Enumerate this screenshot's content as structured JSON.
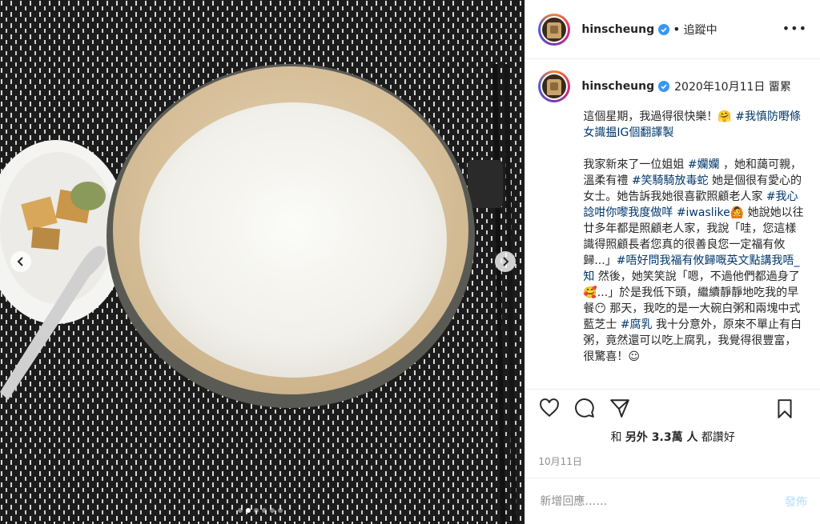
{
  "header": {
    "username": "hinscheung",
    "separator": "•",
    "follow_status": "追蹤中",
    "more_label": "•••"
  },
  "caption": {
    "username": "hinscheung",
    "date_text": "2020年10月11日 畱累",
    "body": [
      {
        "t": "這個星期，我過得很快樂！🤗 "
      },
      {
        "t": "#我慎防嘢條女識揾IG個翻譯製",
        "tag": true
      },
      {
        "t": "\n\n我家新來了一位姐姐 "
      },
      {
        "t": "#孄孄",
        "tag": true
      },
      {
        "t": " ，她和藹可親，溫柔有禮 "
      },
      {
        "t": "#笑騎騎放毒蛇",
        "tag": true
      },
      {
        "t": " 她是個很有愛心的女士。她告訴我她很喜歡照顧老人家 "
      },
      {
        "t": "#我心諗咁你嚟我度做咩",
        "tag": true
      },
      {
        "t": " "
      },
      {
        "t": "#iwaslike",
        "tag": true
      },
      {
        "t": "🙆 她說她以往廿多年都是照顧老人家，我說「哇，您這樣識得照顧長者您真的很善良您一定福有攸歸...」"
      },
      {
        "t": "#唔好問我福有攸歸嘅英文點講我唔_知",
        "tag": true
      },
      {
        "t": " 然後，她笑笑說「嗯，不過他們都過身了🥰...」於是我低下頭，繼續靜靜地吃我的早餐😶 那天，我吃的是一大碗白粥和兩塊中式藍芝士 "
      },
      {
        "t": "#腐乳",
        "tag": true
      },
      {
        "t": " 我十分意外，原來不單止有白粥，竟然還可以吃上腐乳，我覺得很豐富，很驚喜！☺"
      }
    ]
  },
  "actions": {
    "like_icon": "heart-icon",
    "comment_icon": "comment-icon",
    "share_icon": "share-icon",
    "save_icon": "bookmark-icon"
  },
  "likes": {
    "prefix": "和",
    "bold_text": "另外 3.3萬 人",
    "suffix": "都讚好"
  },
  "post_date": "10月11日",
  "comment": {
    "placeholder": "新增回應……",
    "post_label": "發佈"
  },
  "carousel": {
    "dot_count": 6,
    "active_index": 1,
    "prev_icon": "chevron-left-icon",
    "next_icon": "chevron-right-icon"
  },
  "colors": {
    "hashtag": "#00376b",
    "verified": "#3897f0",
    "post_disabled": "#b2dffc",
    "muted": "#8e8e8e"
  }
}
